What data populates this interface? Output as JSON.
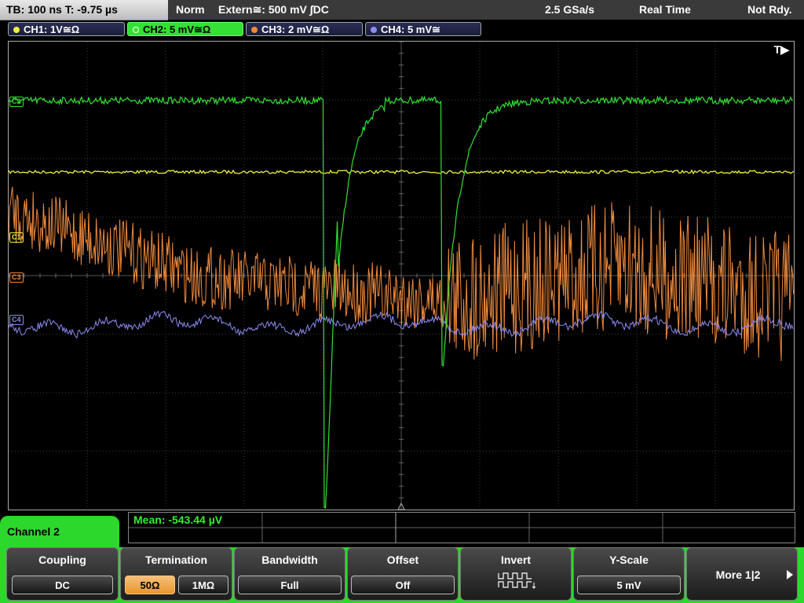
{
  "status_bar": {
    "timebase": "TB: 100 ns   T: -9.75 µs",
    "mode": "Norm",
    "trigger": "Extern≅: 500 mV ∫DC",
    "sample_rate": "2.5 GSa/s",
    "acq_mode": "Real Time",
    "trigger_state": "Not Rdy."
  },
  "channels": [
    {
      "label": "CH1: 1V≅Ω",
      "color": "#f0f040"
    },
    {
      "label": "CH2: 5 mV≅Ω",
      "color": "#33e033"
    },
    {
      "label": "CH3: 2 mV≅Ω",
      "color": "#f08a3c"
    },
    {
      "label": "CH4: 5 mV≅",
      "color": "#8c8cf0"
    }
  ],
  "graticule": {
    "trigger_marker": "T▶",
    "channel_markers": {
      "ch1": "C1",
      "ch2": "C2",
      "ch3": "C3",
      "ch4": "C4"
    }
  },
  "measurement": {
    "mean": "Mean: -543.44 µV"
  },
  "menu": {
    "title": "Channel 2",
    "coupling": {
      "label": "Coupling",
      "value": "DC"
    },
    "termination": {
      "label": "Termination",
      "opt_50": "50Ω",
      "opt_1m": "1MΩ",
      "selected": "50Ω"
    },
    "bandwidth": {
      "label": "Bandwidth",
      "value": "Full"
    },
    "offset": {
      "label": "Offset",
      "value": "Off"
    },
    "invert": {
      "label": "Invert",
      "icon": "invert-waveform-icon"
    },
    "yscale": {
      "label": "Y-Scale",
      "value": "5 mV"
    },
    "more": {
      "label": "More 1|2"
    }
  }
}
